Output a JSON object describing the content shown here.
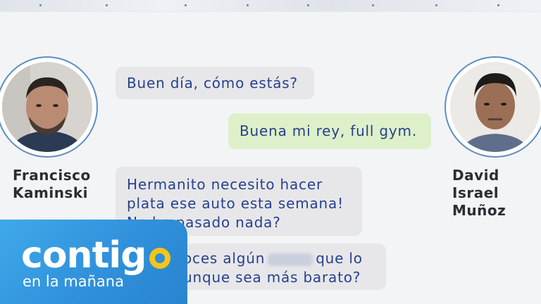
{
  "participants": {
    "left": {
      "name": "Francisco\nKaminski"
    },
    "right": {
      "name": "David Israel\nMuñoz"
    }
  },
  "messages": [
    {
      "side": "in",
      "lines": [
        "Buen día, cómo estás?"
      ]
    },
    {
      "side": "out",
      "lines": [
        "Buena mi rey, full gym."
      ]
    },
    {
      "side": "in",
      "lines": [
        "Hermanito necesito hacer",
        "plata ese auto esta semana!",
        "No ha pasado nada?"
      ]
    },
    {
      "side": "in",
      "lines": [
        "oces algún",
        "que lo",
        "unque sea más barato?"
      ]
    }
  ],
  "logo": {
    "main": "contig",
    "sub": "en la mañana"
  },
  "colors": {
    "bubble_text": "#27418c",
    "incoming_bg": "#e7e7ea",
    "outgoing_bg": "#def0c9",
    "logo_blue": "#2f8fd9",
    "logo_yellow": "#f5c518"
  }
}
